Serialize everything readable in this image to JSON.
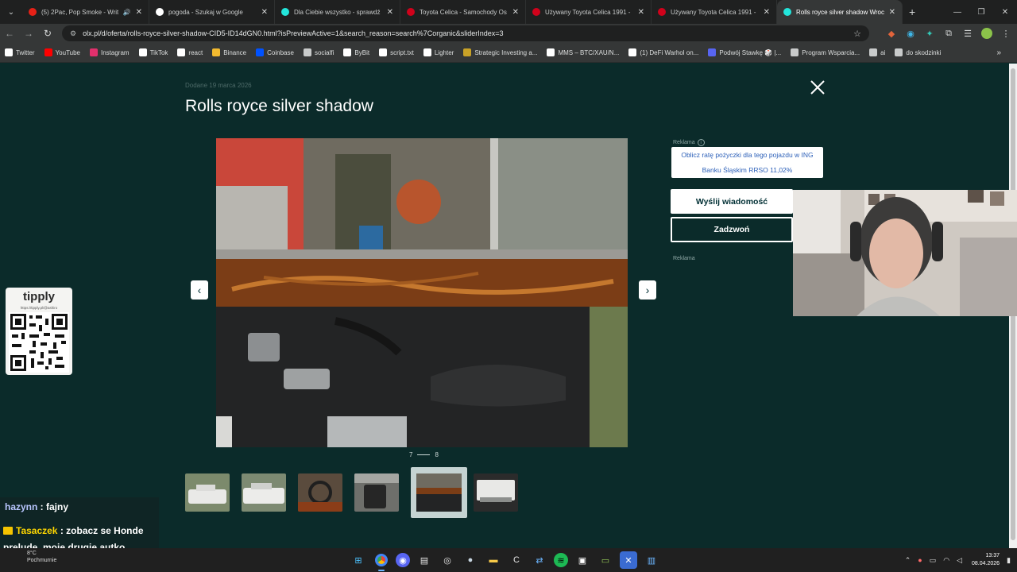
{
  "browser": {
    "tabs": [
      {
        "title": "(5) 2Pac, Pop Smoke - Writ",
        "favicon_color": "#e62117",
        "audio": true
      },
      {
        "title": "pogoda - Szukaj w Google",
        "favicon_color": "#ffffff",
        "audio": false
      },
      {
        "title": "Dla Ciebie wszystko - sprawdź",
        "favicon_color": "#23e5db",
        "audio": false
      },
      {
        "title": "Toyota Celica - Samochody Os",
        "favicon_color": "#d0021b",
        "audio": false
      },
      {
        "title": "Używany Toyota Celica 1991 - ",
        "favicon_color": "#d0021b",
        "audio": false
      },
      {
        "title": "Używany Toyota Celica 1991 - ",
        "favicon_color": "#d0021b",
        "audio": false
      },
      {
        "title": "Rolls royce silver shadow Wroc",
        "favicon_color": "#23e5db",
        "audio": false,
        "active": true
      }
    ],
    "url": "olx.pl/d/oferta/rolls-royce-silver-shadow-CID5-ID14dGN0.html?isPreviewActive=1&search_reason=search%7Corganic&sliderIndex=3",
    "bookmarks": [
      {
        "label": "Twitter",
        "color": "#ffffff"
      },
      {
        "label": "YouTube",
        "color": "#ff0000"
      },
      {
        "label": "Instagram",
        "color": "#e1306c"
      },
      {
        "label": "TikTok",
        "color": "#ffffff"
      },
      {
        "label": "react",
        "color": "#ffffff"
      },
      {
        "label": "Binance",
        "color": "#f3ba2f"
      },
      {
        "label": "Coinbase",
        "color": "#0052ff"
      },
      {
        "label": "socialfi",
        "color": "#c9cbcb"
      },
      {
        "label": "ByBit",
        "color": "#ffffff"
      },
      {
        "label": "script.txt",
        "color": "#ffffff"
      },
      {
        "label": "Lighter",
        "color": "#ffffff"
      },
      {
        "label": "Strategic Investing a...",
        "color": "#c9a227"
      },
      {
        "label": "MMS – BTC/XAU/N...",
        "color": "#ffffff"
      },
      {
        "label": "(1) DeFi Warhol on...",
        "color": "#ffffff"
      },
      {
        "label": "Podwój Stawkę 🎲 |...",
        "color": "#5865f2"
      },
      {
        "label": "Program Wsparcia...",
        "color": "#c9cbcb"
      },
      {
        "label": "ai",
        "color": "#c9cbcb"
      },
      {
        "label": "do skodzinki",
        "color": "#c9cbcb"
      }
    ]
  },
  "listing": {
    "added": "Dodane 19 marca 2026",
    "title": "Rolls royce silver shadow",
    "counter_current": "7",
    "counter_total": "8",
    "ad_label": "Reklama",
    "ing_text": "Oblicz ratę pożyczki dla tego pojazdu w ING Banku Śląskim RRSO 11,02%",
    "message_button": "Wyślij wiadomość",
    "call_button": "Zadzwoń",
    "ad_label_2": "Reklama"
  },
  "overlay": {
    "tippy_name": "tipply",
    "tippy_link": "https://tipply.pl/@ashiro",
    "chat": [
      {
        "user": "hazynn",
        "text": "fajny"
      },
      {
        "user": "Tasaczek",
        "text": "zobacz se Honde prelude, moje drugie autko"
      }
    ],
    "weather_temp": "8°C",
    "weather_desc": "Pochmurnie"
  },
  "taskbar": {
    "time": "13:37",
    "date": "08.04.2026"
  }
}
